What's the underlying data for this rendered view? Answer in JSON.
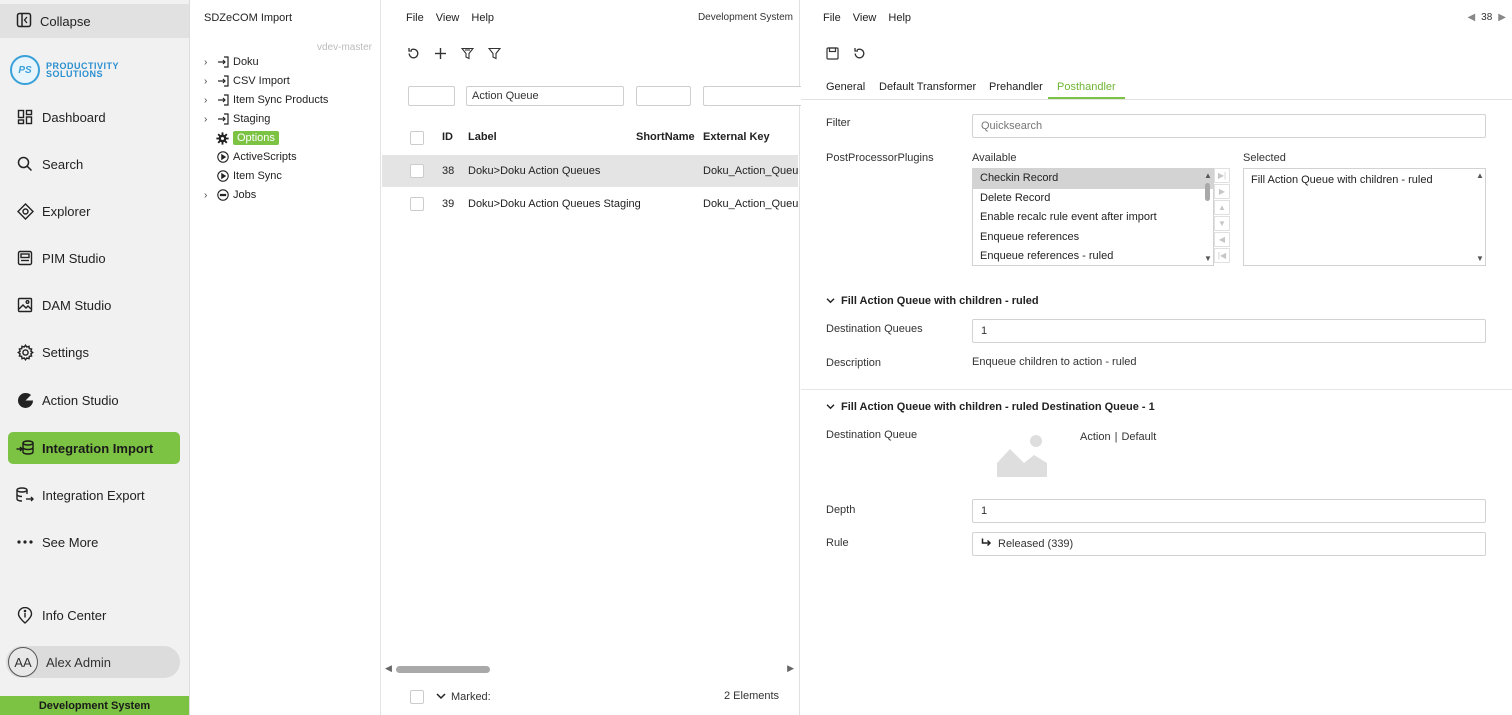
{
  "nav": {
    "collapse_label": "Collapse",
    "logo_badge": "PS",
    "logo_line1": "PRODUCTIVITY",
    "logo_line2": "SOLUTIONS",
    "items": [
      {
        "label": "Dashboard",
        "icon": "dashboard-icon"
      },
      {
        "label": "Search",
        "icon": "search-icon"
      },
      {
        "label": "Explorer",
        "icon": "explorer-icon"
      },
      {
        "label": "PIM Studio",
        "icon": "pim-studio-icon"
      },
      {
        "label": "DAM Studio",
        "icon": "image-icon"
      },
      {
        "label": "Settings",
        "icon": "gear-icon"
      },
      {
        "label": "Action Studio",
        "icon": "action-studio-icon"
      },
      {
        "label": "Integration Import",
        "icon": "import-icon",
        "active": true
      },
      {
        "label": "Integration Export",
        "icon": "export-icon"
      },
      {
        "label": "See More",
        "icon": "more-icon"
      }
    ],
    "info_center": "Info Center",
    "user_initials": "AA",
    "user_name": "Alex Admin",
    "system_label": "Development System",
    "accent_color": "#7cc243"
  },
  "tree": {
    "title": "SDZeCOM Import",
    "branch": "vdev-master",
    "nodes": [
      {
        "label": "Doku",
        "expandable": true,
        "icon": "import-node-icon"
      },
      {
        "label": "CSV Import",
        "expandable": true,
        "icon": "import-node-icon"
      },
      {
        "label": "Item Sync Products",
        "expandable": true,
        "icon": "import-node-icon"
      },
      {
        "label": "Staging",
        "expandable": true,
        "icon": "import-node-icon"
      },
      {
        "label": "Options",
        "expandable": false,
        "icon": "gear-icon",
        "selected": true
      },
      {
        "label": "ActiveScripts",
        "expandable": false,
        "icon": "play-icon"
      },
      {
        "label": "Item Sync",
        "expandable": false,
        "icon": "play-icon"
      },
      {
        "label": "Jobs",
        "expandable": true,
        "icon": "jobs-icon"
      }
    ]
  },
  "list": {
    "menu": [
      "File",
      "View",
      "Help"
    ],
    "system": "Development System",
    "filters": {
      "id": "",
      "label": "Action Queue",
      "shortname": "",
      "external_key": ""
    },
    "columns": {
      "id": "ID",
      "label": "Label",
      "shortname": "ShortName",
      "external_key": "External Key"
    },
    "rows": [
      {
        "id": "38",
        "label": "Doku>Doku Action Queues",
        "shortname": "",
        "external_key": "Doku_Action_Queues",
        "selected": true
      },
      {
        "id": "39",
        "label": "Doku>Doku Action Queues Staging",
        "shortname": "",
        "external_key": "Doku_Action_Queues"
      }
    ],
    "footer_marked": "Marked:",
    "footer_count": "2 Elements"
  },
  "detail": {
    "menu": [
      "File",
      "View",
      "Help"
    ],
    "record_id": "38",
    "tabs": [
      "General",
      "Default Transformer",
      "Prehandler",
      "Posthandler"
    ],
    "active_tab": "Posthandler",
    "filter_label": "Filter",
    "filter_placeholder": "Quicksearch",
    "plugins_label": "PostProcessorPlugins",
    "available_label": "Available",
    "selected_label": "Selected",
    "available_items": [
      "Checkin Record",
      "Delete Record",
      "Enable recalc rule event after import",
      "Enqueue references",
      "Enqueue references - ruled"
    ],
    "selected_items": [
      "Fill Action Queue with children - ruled"
    ],
    "section1": {
      "title": "Fill Action Queue with children - ruled",
      "dest_queues_label": "Destination Queues",
      "dest_queues_value": "1",
      "description_label": "Description",
      "description_value": "Enqueue children to action - ruled"
    },
    "section2": {
      "title": "Fill Action Queue with children - ruled Destination Queue - 1",
      "dest_queue_label": "Destination Queue",
      "dest_queue_value": "Action",
      "dest_queue_sep": "|",
      "dest_queue_extra": "Default",
      "depth_label": "Depth",
      "depth_value": "1",
      "rule_label": "Rule",
      "rule_value": "Released (339)"
    }
  }
}
